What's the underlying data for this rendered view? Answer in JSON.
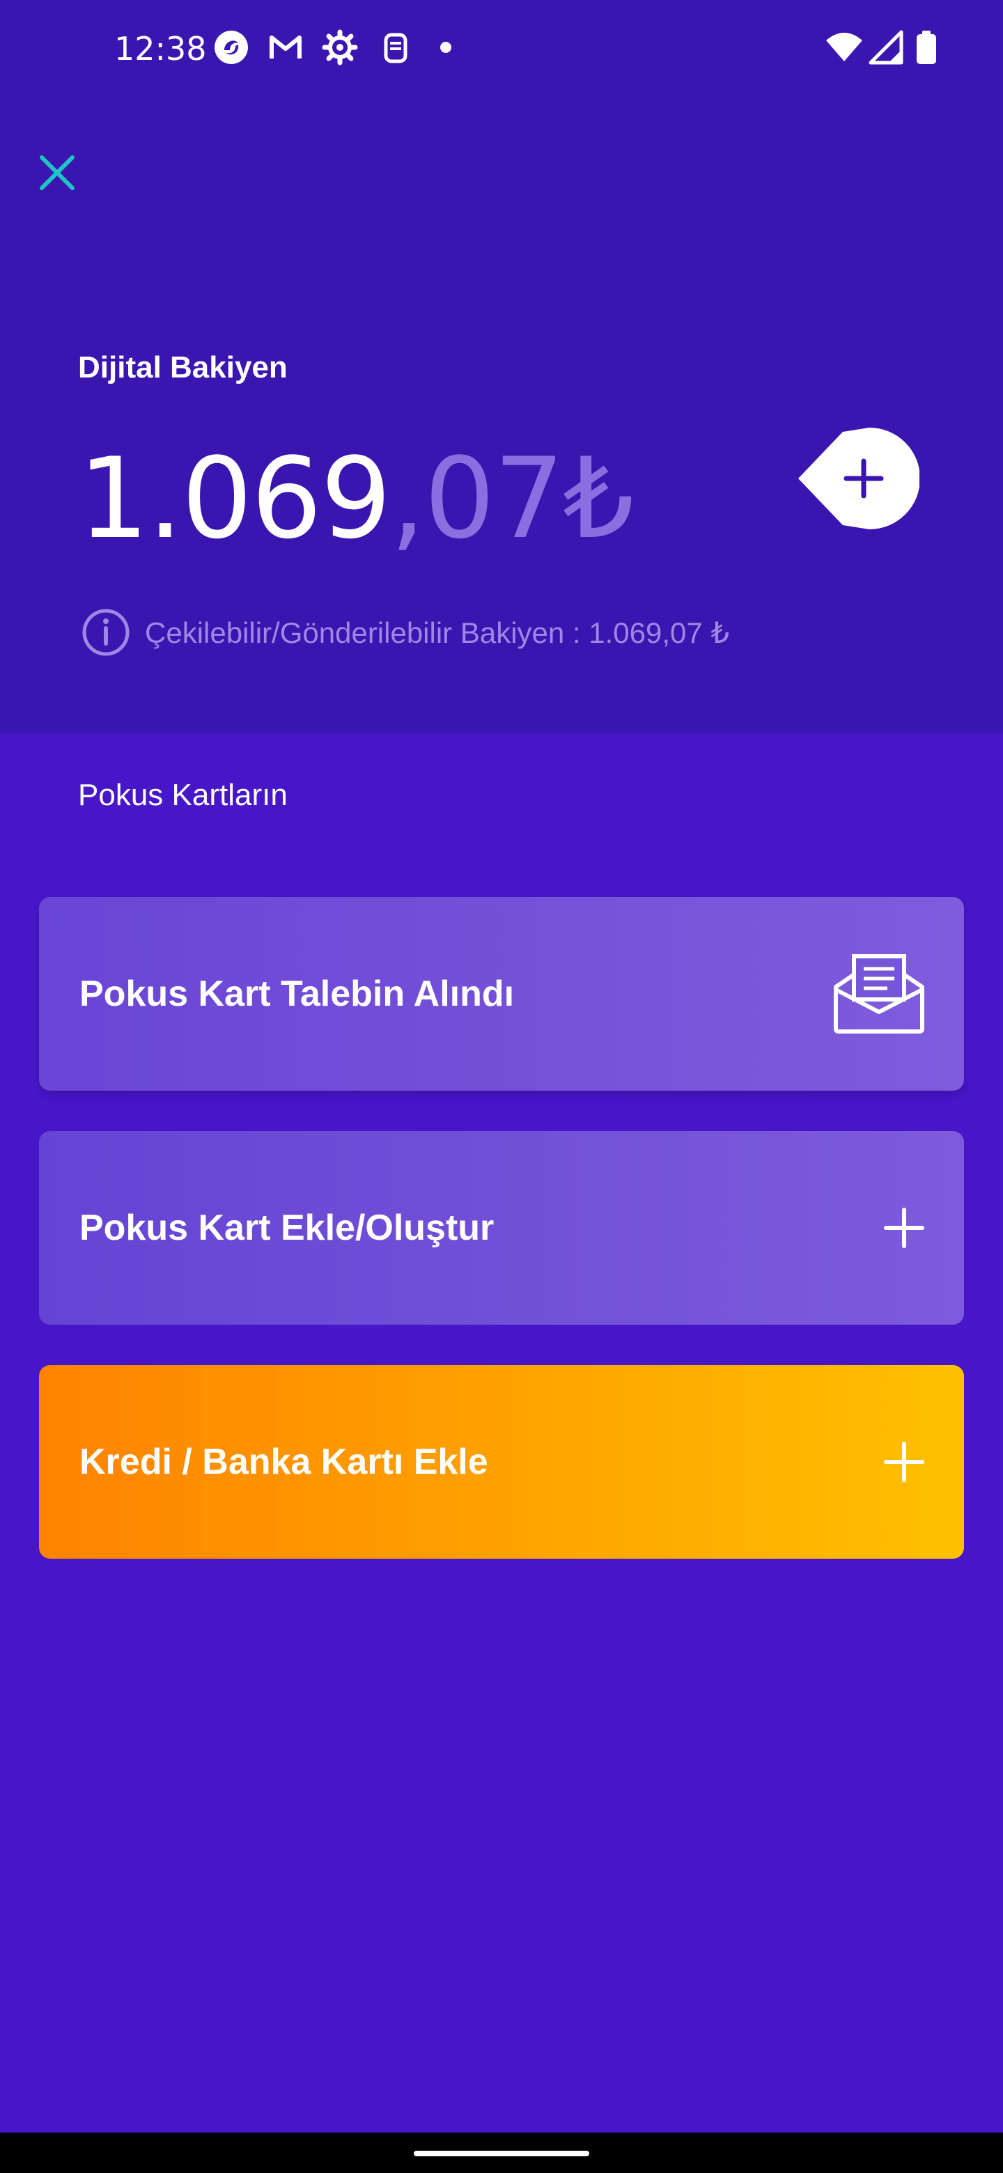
{
  "status_bar": {
    "time": "12:38",
    "left_icons": [
      "pokus-app-icon",
      "gmail-icon",
      "settings-icon",
      "clipboard-icon",
      "notification-dot"
    ],
    "right_icons": [
      "wifi-icon",
      "cellular-signal-icon",
      "battery-icon"
    ]
  },
  "header": {
    "close_icon": "close-icon",
    "balance_label": "Dijital Bakiyen",
    "balance_integer": "1.069",
    "balance_decimal": ",07₺",
    "add_icon": "plus-icon",
    "info_text": "Çekilebilir/Gönderilebilir Bakiyen : 1.069,07 ₺"
  },
  "cards_section": {
    "title": "Pokus Kartların",
    "cards": [
      {
        "label": "Pokus Kart Talebin Alındı",
        "icon": "mail-open-icon"
      },
      {
        "label": "Pokus Kart Ekle/Oluştur",
        "icon": "plus-icon"
      },
      {
        "label": "Kredi / Banka Kartı Ekle",
        "icon": "plus-icon"
      }
    ]
  },
  "colors": {
    "header_bg": "#3A15B0",
    "page_bg": "#4616C8",
    "accent_teal": "#1DC5C5",
    "orange_start": "#FF8300",
    "orange_end": "#FFC000"
  }
}
